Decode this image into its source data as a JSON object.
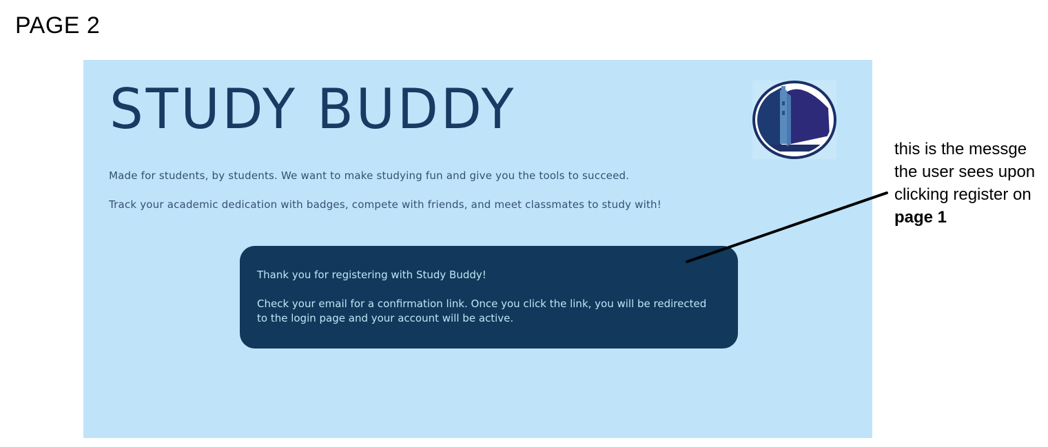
{
  "page_label": "PAGE 2",
  "app": {
    "title": "STUDY BUDDY",
    "tagline_1": "Made for students, by students. We want to make studying fun and give you the tools to succeed.",
    "tagline_2": "Track your academic dedication with badges, compete with friends, and meet classmates to study with!"
  },
  "message": {
    "line_1": "Thank you for registering with Study Buddy!",
    "line_2": "Check your email for a confirmation link. Once you click the link, you will be redirected to the login page and your account will be active."
  },
  "annotation": {
    "text_part_1": "this is the messge the user sees upon clicking register on",
    "text_part_2": "page 1"
  },
  "colors": {
    "mockup_bg": "#bfe4fa",
    "brand_text": "#183a63",
    "message_bg": "#12385b",
    "message_text": "#bfe6f5"
  }
}
